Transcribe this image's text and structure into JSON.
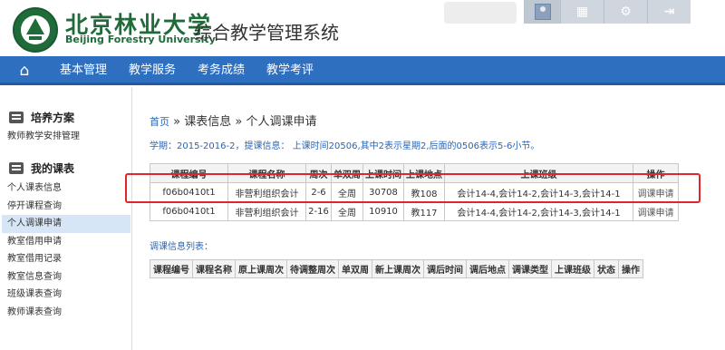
{
  "header": {
    "school_cn": "北京林业大学",
    "school_en": "Beijing Forestry University",
    "system_title": "综合教学管理系统"
  },
  "tools": [
    {
      "name": "user-avatar-icon"
    },
    {
      "icon": "▦",
      "name": "apps-grid-icon"
    },
    {
      "icon": "⚙",
      "name": "settings-gear-icon"
    },
    {
      "icon": "⇥",
      "name": "logout-icon"
    }
  ],
  "nav": {
    "home_icon": "⌂",
    "items": [
      "基本管理",
      "教学服务",
      "考务成绩",
      "教学考评"
    ]
  },
  "sidebar": {
    "groups": [
      {
        "label": "培养方案",
        "items": [
          "教师教学安排管理"
        ]
      },
      {
        "label": "我的课表",
        "items": [
          "个人课表信息",
          "停开课程查询",
          "个人调课申请",
          "教室借用申请",
          "教室借用记录",
          "教室信息查询",
          "班级课表查询",
          "教师课表查询"
        ]
      }
    ],
    "active_item": "个人调课申请"
  },
  "breadcrumb": {
    "home": "首页",
    "sep1": "»",
    "item1": "课表信息",
    "sep2": "»",
    "item2": "个人调课申请"
  },
  "term_info": "学期：2015-2016-2，提课信息： 上课时间20506,其中2表示星期2,后面的0506表示5-6小节。",
  "course_table": {
    "headers": [
      "课程编号",
      "课程名称",
      "周次",
      "单双周",
      "上课时间",
      "上课地点",
      "上课班级",
      "操作"
    ],
    "rows": [
      [
        "f06b0410t1",
        "非营利组织会计",
        "2-6",
        "全周",
        "30708",
        "教108",
        "会计14-4,会计14-2,会计14-3,会计14-1",
        "调课申请"
      ],
      [
        "f06b0410t1",
        "非营利组织会计",
        "2-16",
        "全周",
        "10910",
        "教117",
        "会计14-4,会计14-2,会计14-3,会计14-1",
        "调课申请"
      ]
    ]
  },
  "adjust_list": {
    "title": "调课信息列表：",
    "headers": [
      "课程编号",
      "课程名称",
      "原上课周次",
      "待调整周次",
      "单双周",
      "新上课周次",
      "调后时间",
      "调后地点",
      "调课类型",
      "上课班级",
      "状态",
      "操作"
    ]
  },
  "colors": {
    "brand_green": "#1f6b3a",
    "nav_blue": "#2f6fbf",
    "link_blue": "#2a66b5",
    "highlight_red": "#e0252b"
  }
}
